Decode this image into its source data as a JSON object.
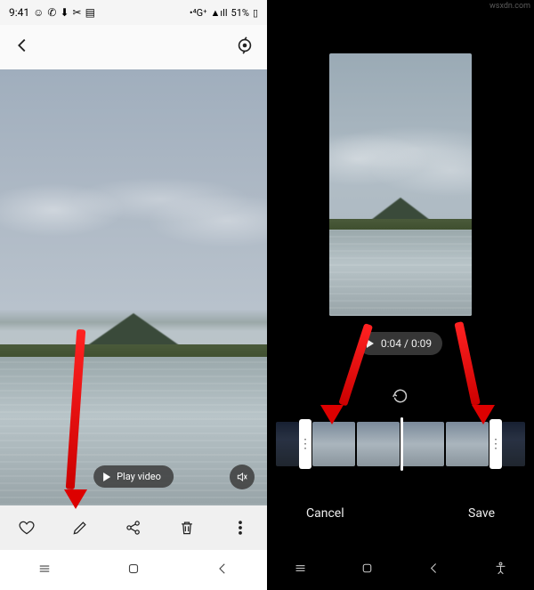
{
  "status": {
    "time": "9:41",
    "icons_left": [
      "whatsapp-icon",
      "phone-icon",
      "download-icon",
      "screenshot-icon",
      "sdcard-icon"
    ],
    "network": "•⁴G⁺",
    "signal": "▲ıll",
    "battery_text": "51%",
    "battery_icon": "battery-half-icon"
  },
  "viewer": {
    "back_icon": "chevron-left-icon",
    "smart_icon": "rotate-smart-icon",
    "play_label": "Play video",
    "mute_icon": "volume-off-icon",
    "actions": {
      "favorite": "heart-icon",
      "edit": "pencil-icon",
      "share": "share-icon",
      "delete": "trash-icon",
      "more": "more-vertical-icon"
    }
  },
  "editor": {
    "playback": "0:04 / 0:09",
    "undo_icon": "undo-icon",
    "trim": {
      "left_handle": "trim-handle-left",
      "right_handle": "trim-handle-right",
      "playhead": "playhead"
    },
    "cancel_label": "Cancel",
    "save_label": "Save"
  },
  "nav": {
    "recents": "recents-icon",
    "home": "home-icon",
    "back": "back-icon",
    "accessibility": "accessibility-icon"
  },
  "watermark": "wsxdn.com"
}
